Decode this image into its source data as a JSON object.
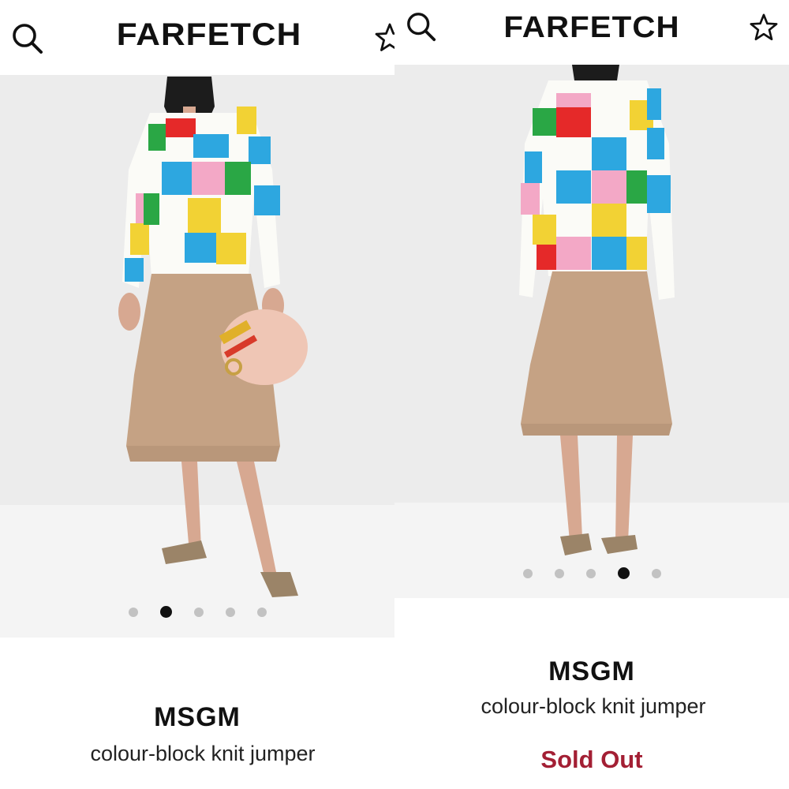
{
  "colors": {
    "sold_out": "#a31f34",
    "dot_active": "#111111",
    "dot_inactive": "#c2c2c2",
    "photo_bg": "#ececec"
  },
  "left": {
    "header": {
      "logo": "FARFETCH",
      "search_icon": "search-icon",
      "wishlist_icon": "star-outline-icon"
    },
    "carousel": {
      "total": 5,
      "active_index": 1
    },
    "product": {
      "brand": "MSGM",
      "name": "colour-block knit jumper"
    }
  },
  "right": {
    "header": {
      "logo": "FARFETCH",
      "search_icon": "search-icon",
      "wishlist_icon": "star-outline-icon"
    },
    "carousel": {
      "total": 5,
      "active_index": 3
    },
    "product": {
      "brand": "MSGM",
      "name": "colour-block knit jumper",
      "status": "Sold Out"
    }
  }
}
